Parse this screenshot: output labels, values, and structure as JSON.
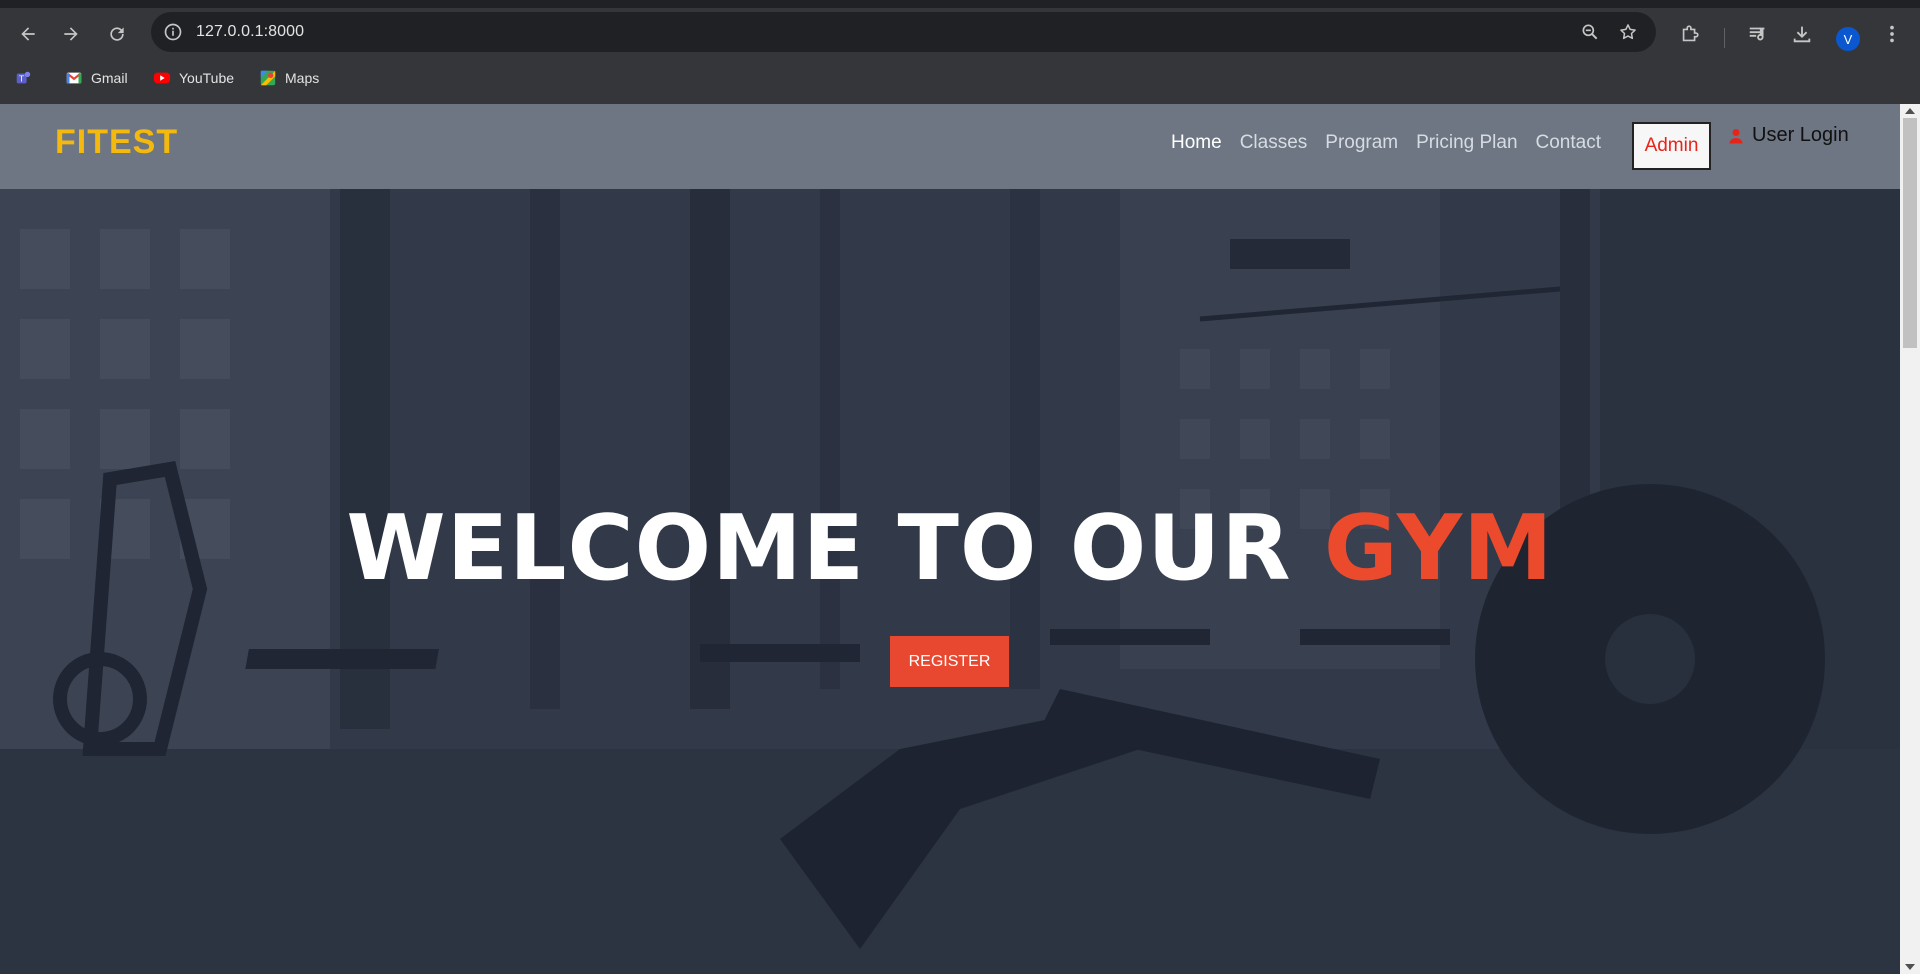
{
  "browser": {
    "url": "127.0.0.1:8000",
    "avatar_letter": "V",
    "bookmarks": [
      {
        "label": "Gmail",
        "icon": "gmail-icon"
      },
      {
        "label": "YouTube",
        "icon": "youtube-icon"
      },
      {
        "label": "Maps",
        "icon": "maps-icon"
      }
    ]
  },
  "site": {
    "brand": "FITEST",
    "nav": {
      "home": "Home",
      "classes": "Classes",
      "program": "Program",
      "pricing": "Pricing Plan",
      "contact": "Contact"
    },
    "admin_label": "Admin",
    "user_login_label": "User Login",
    "hero": {
      "title_main": "WELCOME TO OUR ",
      "title_accent": "GYM",
      "register_label": "REGISTER"
    }
  },
  "colors": {
    "brand": "#f4b90e",
    "accent": "#ec4a2d",
    "nav_bg": "#6d7682",
    "admin_text": "#e8241a"
  }
}
